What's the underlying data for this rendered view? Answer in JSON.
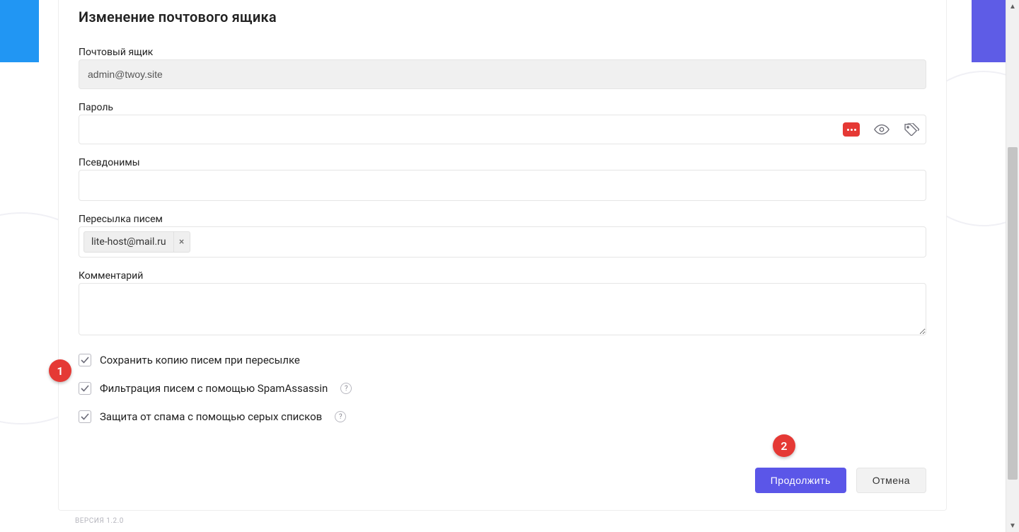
{
  "pageTitle": "Изменение почтового ящика",
  "labels": {
    "mailbox": "Почтовый ящик",
    "password": "Пароль",
    "aliases": "Псевдонимы",
    "forwarding": "Пересылка писем",
    "comment": "Комментарий"
  },
  "values": {
    "mailbox": "admin@twoy.site",
    "password": "",
    "aliases": "",
    "comment": ""
  },
  "forwardingChips": [
    {
      "label": "lite-host@mail.ru"
    }
  ],
  "checkboxes": [
    {
      "label": "Сохранить копию писем при пересылке",
      "checked": true,
      "help": false
    },
    {
      "label": "Фильтрация писем с помощью SpamAssassin",
      "checked": true,
      "help": true
    },
    {
      "label": "Защита от спама с помощью серых списков",
      "checked": true,
      "help": true
    }
  ],
  "buttons": {
    "primary": "Продолжить",
    "secondary": "Отмена"
  },
  "versionLabel": "ВЕРСИЯ 1.2.0",
  "callouts": {
    "c1": "1",
    "c2": "2"
  },
  "colors": {
    "leftAccent": "#2196f3",
    "rightAccent": "#5e5ce6",
    "primaryButton": "#5b56e8",
    "calloutRed": "#e53935"
  }
}
